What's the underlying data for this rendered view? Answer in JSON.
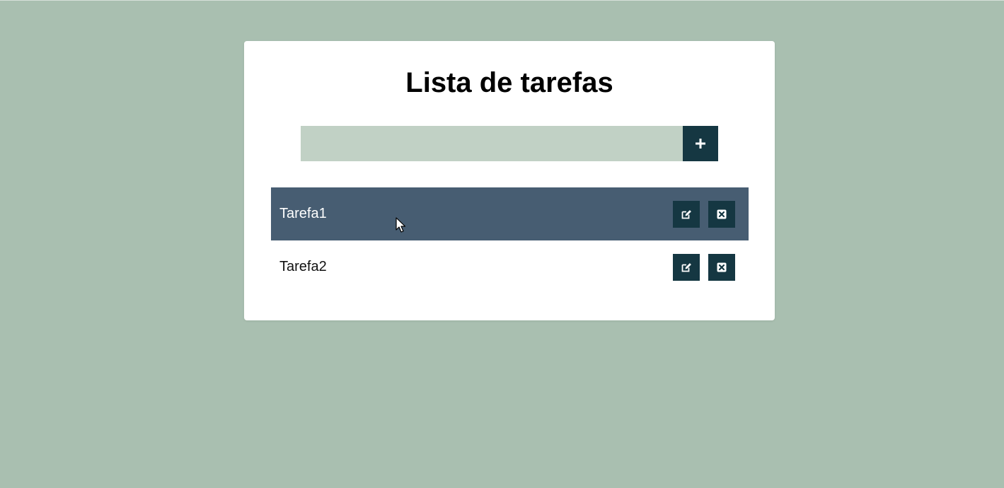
{
  "page": {
    "title": "Lista de tarefas"
  },
  "form": {
    "input_value": "",
    "input_placeholder": "",
    "add_icon": "plus-icon"
  },
  "tasks": [
    {
      "label": "Tarefa1",
      "hovered": true,
      "edit_icon": "edit-icon",
      "delete_icon": "close-icon"
    },
    {
      "label": "Tarefa2",
      "hovered": false,
      "edit_icon": "edit-icon",
      "delete_icon": "close-icon"
    }
  ],
  "colors": {
    "background": "#a9bfb0",
    "card": "#ffffff",
    "input_bg": "#c1d1c5",
    "button_bg": "#153742",
    "hover_row": "#475d72"
  }
}
